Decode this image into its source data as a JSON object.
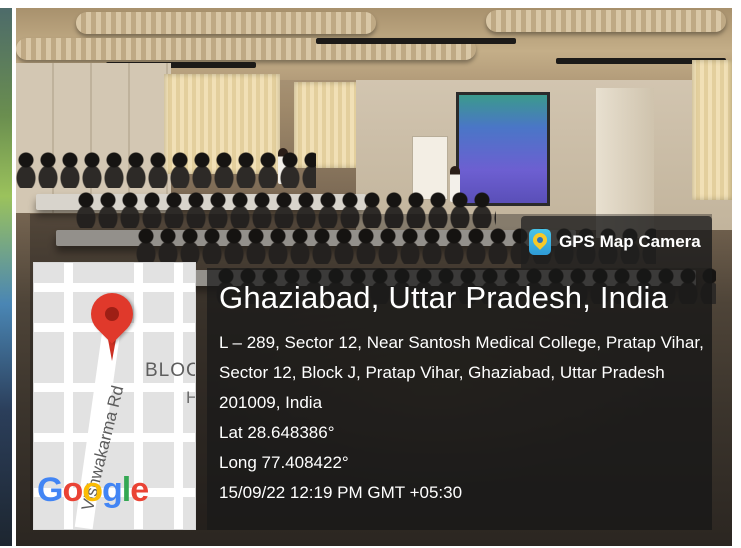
{
  "watermark": {
    "app_badge": "GPS Map Camera",
    "location_title": "Ghaziabad, Uttar Pradesh, India",
    "address_lines": [
      "L – 289, Sector 12, Near Santosh Medical College, Pratap Vihar,",
      "Sector 12, Block J, Pratap Vihar, Ghaziabad, Uttar Pradesh",
      "201009, India"
    ],
    "latitude": "Lat 28.648386°",
    "longitude": "Long 77.408422°",
    "timestamp": "15/09/22 12:19 PM GMT +05:30"
  },
  "map": {
    "road_label": "Vishwakarma Rd",
    "block_label": "BLOCK",
    "block_suffix": "H",
    "logo": [
      "G",
      "o",
      "o",
      "g",
      "l",
      "e"
    ],
    "pin_color": "#e0392b"
  },
  "colors": {
    "panel_bg": "rgba(25,25,25,0.72)",
    "text": "#ffffff"
  }
}
